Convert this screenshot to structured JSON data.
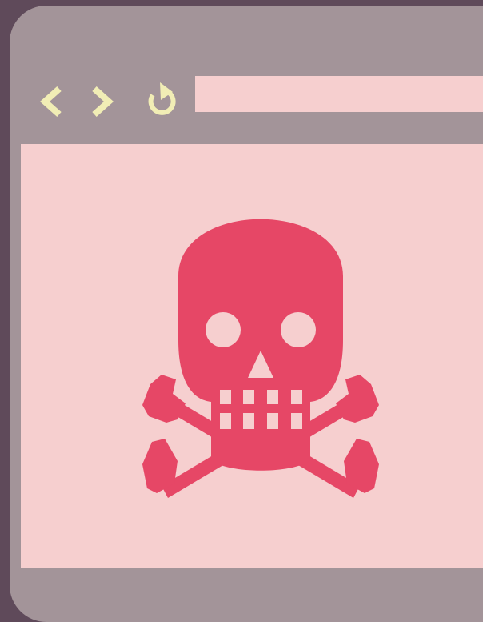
{
  "browser": {
    "back_icon": "chevron-left-icon",
    "forward_icon": "chevron-right-icon",
    "reload_icon": "reload-icon",
    "address": "",
    "content_icon": "skull-and-crossbones-icon"
  },
  "colors": {
    "backdrop": "#5f4a5a",
    "frame": "#a39499",
    "page": "#f6cfcf",
    "controls": "#f1edb5",
    "skull": "#e64766"
  }
}
